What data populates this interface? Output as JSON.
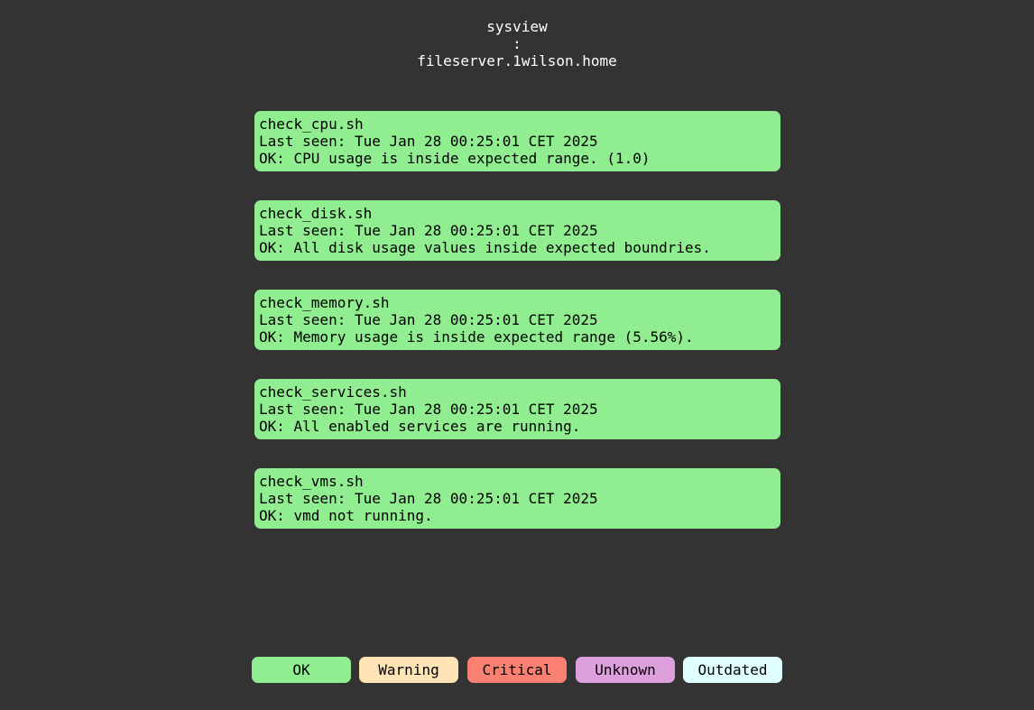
{
  "header": {
    "app": "sysview",
    "separator": ":",
    "host": "fileserver.1wilson.home"
  },
  "colors": {
    "ok": "#90ee90",
    "warning": "#ffe4b5",
    "critical": "#fa8072",
    "unknown": "#dda0dd",
    "outdated": "#e0ffff",
    "background": "#333333"
  },
  "checks": [
    {
      "name": "check_cpu.sh",
      "last_seen": "Last seen: Tue Jan 28 00:25:01 CET 2025",
      "message": "OK: CPU usage is inside expected range. (1.0)",
      "status": "ok"
    },
    {
      "name": "check_disk.sh",
      "last_seen": "Last seen: Tue Jan 28 00:25:01 CET 2025",
      "message": "OK: All disk usage values inside expected boundries.",
      "status": "ok"
    },
    {
      "name": "check_memory.sh",
      "last_seen": "Last seen: Tue Jan 28 00:25:01 CET 2025",
      "message": "OK: Memory usage is inside expected range (5.56%).",
      "status": "ok"
    },
    {
      "name": "check_services.sh",
      "last_seen": "Last seen: Tue Jan 28 00:25:01 CET 2025",
      "message": "OK: All enabled services are running.",
      "status": "ok"
    },
    {
      "name": "check_vms.sh",
      "last_seen": "Last seen: Tue Jan 28 00:25:01 CET 2025",
      "message": "OK: vmd not running.",
      "status": "ok"
    }
  ],
  "legend": [
    {
      "label": "OK",
      "status": "ok"
    },
    {
      "label": "Warning",
      "status": "warning"
    },
    {
      "label": "Critical",
      "status": "critical"
    },
    {
      "label": "Unknown",
      "status": "unknown"
    },
    {
      "label": "Outdated",
      "status": "outdated"
    }
  ]
}
